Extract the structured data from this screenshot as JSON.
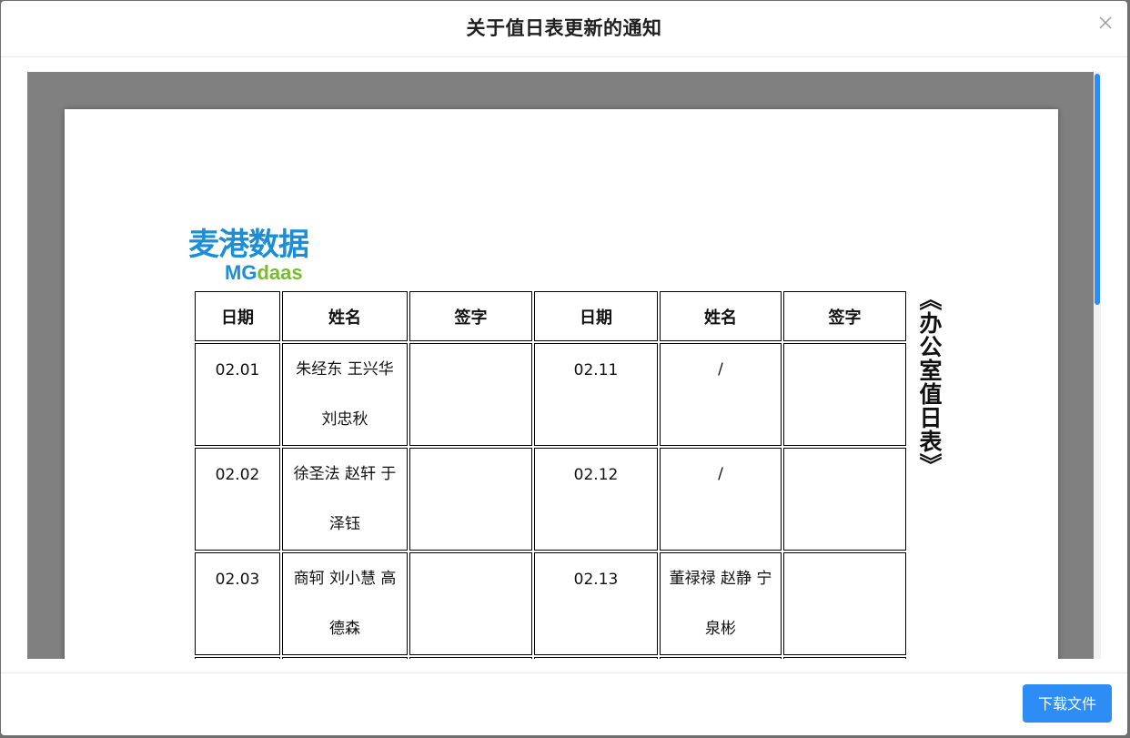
{
  "dialog": {
    "title": "关于值日表更新的通知",
    "download_label": "下载文件"
  },
  "document": {
    "logo": {
      "cn": "麦港数据",
      "en_mg": "MG",
      "en_daas": "daas"
    },
    "vertical_title": "《办公室值日表》",
    "headers": [
      "日期",
      "姓名",
      "签字",
      "日期",
      "姓名",
      "签字"
    ],
    "rows": [
      {
        "date1": "02.01",
        "name1": "朱经东 王兴华 刘忠秋",
        "sign1": "",
        "date2": "02.11",
        "name2": "/",
        "sign2": ""
      },
      {
        "date1": "02.02",
        "name1": "徐圣法 赵轩 于泽钰",
        "sign1": "",
        "date2": "02.12",
        "name2": "/",
        "sign2": ""
      },
      {
        "date1": "02.03",
        "name1": "商轲 刘小慧 高德森",
        "sign1": "",
        "date2": "02.13",
        "name2": "董禄禄 赵静 宁泉彬",
        "sign2": ""
      }
    ]
  },
  "colors": {
    "primary": "#2e8df5",
    "logo_blue": "#1a8fd8",
    "logo_green": "#7bbb2e",
    "viewer_bg": "#808080"
  },
  "icons": {
    "close": "close-icon"
  }
}
